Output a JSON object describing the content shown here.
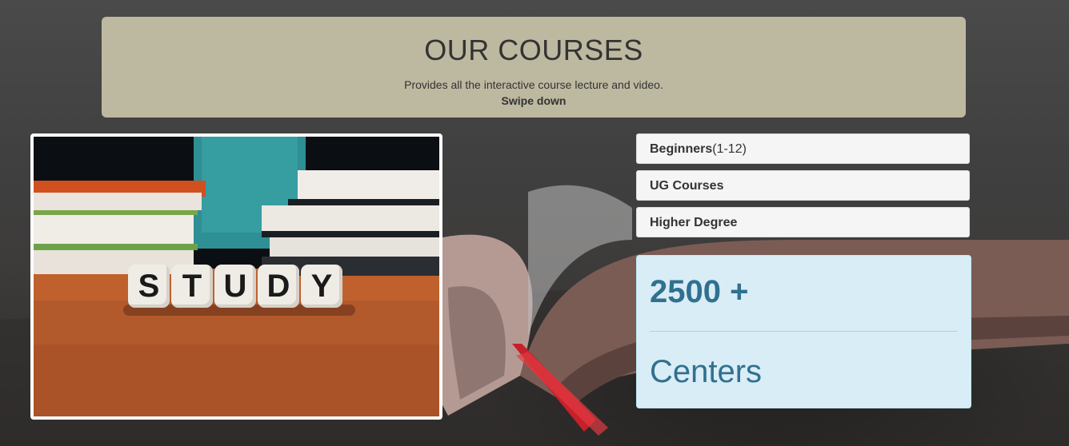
{
  "header": {
    "title": "OUR COURSES",
    "subtitle": "Provides all the interactive course lecture and video.",
    "hint": "Swipe down"
  },
  "image": {
    "dice_letters": [
      "S",
      "T",
      "U",
      "D",
      "Y"
    ]
  },
  "courses": [
    {
      "label": "Beginners",
      "suffix": "(1-12)"
    },
    {
      "label": "UG Courses",
      "suffix": ""
    },
    {
      "label": "Higher Degree",
      "suffix": ""
    }
  ],
  "stats": {
    "number": "2500 +",
    "label": "Centers"
  },
  "colors": {
    "header_bg": "#bdb8a0",
    "stats_bg": "#d9edf7",
    "stats_text": "#31708f",
    "list_bg": "#f5f5f5"
  }
}
